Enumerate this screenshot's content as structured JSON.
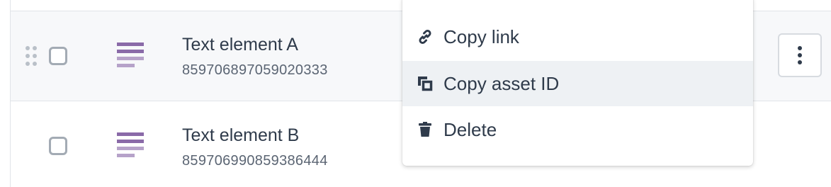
{
  "rows": [
    {
      "title": "Text element A",
      "id": "859706897059020333",
      "icon": "text-lines-icon",
      "hovered": true
    },
    {
      "title": "Text element B",
      "id": "859706990859386444",
      "icon": "text-lines-icon",
      "hovered": false
    }
  ],
  "menu": {
    "items": [
      {
        "label": "Copy link",
        "icon": "link-icon"
      },
      {
        "label": "Copy asset ID",
        "icon": "copy-icon"
      },
      {
        "label": "Delete",
        "icon": "trash-icon"
      }
    ]
  },
  "colors": {
    "text": "#2f3b4b",
    "icon_purple": "#8a6aa8",
    "icon_purple_light": "#b6a2c9",
    "hover_row": "#f7f8fa",
    "menu_hover": "#eef1f4"
  }
}
